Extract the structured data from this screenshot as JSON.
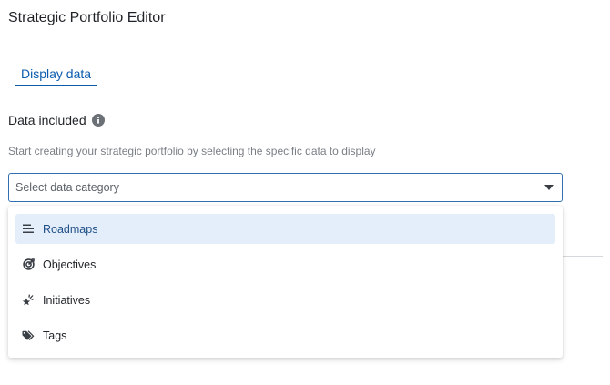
{
  "page": {
    "title": "Strategic Portfolio Editor"
  },
  "tabs": [
    {
      "label": "Display data",
      "active": true
    }
  ],
  "section": {
    "heading": "Data included",
    "info_icon": "info-circle-icon",
    "helper_text": "Start creating your strategic portfolio by selecting the specific data to display"
  },
  "select": {
    "placeholder": "Select data category",
    "caret_icon": "caret-down-icon",
    "options": [
      {
        "label": "Roadmaps",
        "icon": "roadmap-lines-icon",
        "highlighted": true
      },
      {
        "label": "Objectives",
        "icon": "target-icon",
        "highlighted": false
      },
      {
        "label": "Initiatives",
        "icon": "initiative-sparkle-icon",
        "highlighted": false
      },
      {
        "label": "Tags",
        "icon": "tags-icon",
        "highlighted": false
      }
    ]
  },
  "colors": {
    "accent": "#0b5cad",
    "highlight_bg": "#e4eefb",
    "border": "#2f6fb0"
  }
}
